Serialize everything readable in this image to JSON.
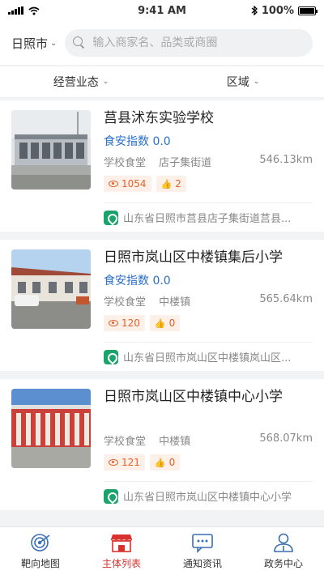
{
  "status": {
    "time": "9:41 AM",
    "battery": "100%"
  },
  "header": {
    "city": "日照市",
    "search_placeholder": "输入商家名、品类或商圈"
  },
  "filters": [
    {
      "label": "经营业态"
    },
    {
      "label": "区域"
    }
  ],
  "items": [
    {
      "name": "莒县沭东实验学校",
      "index_label": "食安指数",
      "index_value": "0.0",
      "category": "学校食堂",
      "street": "店子集街道",
      "distance": "546.13km",
      "views": "1054",
      "likes": "2",
      "address": "山东省日照市莒县店子集街道莒县..."
    },
    {
      "name": "日照市岚山区中楼镇集后小学",
      "index_label": "食安指数",
      "index_value": "0.0",
      "category": "学校食堂",
      "street": "中楼镇",
      "distance": "565.64km",
      "views": "120",
      "likes": "0",
      "address": "山东省日照市岚山区中楼镇岚山区..."
    },
    {
      "name": "日照市岚山区中楼镇中心小学",
      "index_label": "",
      "index_value": "",
      "category": "学校食堂",
      "street": "中楼镇",
      "distance": "568.07km",
      "views": "121",
      "likes": "0",
      "address": "山东省日照市岚山区中楼镇中心小学"
    }
  ],
  "tabs": [
    {
      "label": "靶向地图",
      "icon": "target-icon"
    },
    {
      "label": "主体列表",
      "icon": "store-icon"
    },
    {
      "label": "通知资讯",
      "icon": "message-icon"
    },
    {
      "label": "政务中心",
      "icon": "user-icon"
    }
  ],
  "colors": {
    "accent": "#d8322e",
    "index_blue": "#2a6fc9",
    "badge_orange": "#e2622b",
    "pin_green": "#1aa36a"
  }
}
